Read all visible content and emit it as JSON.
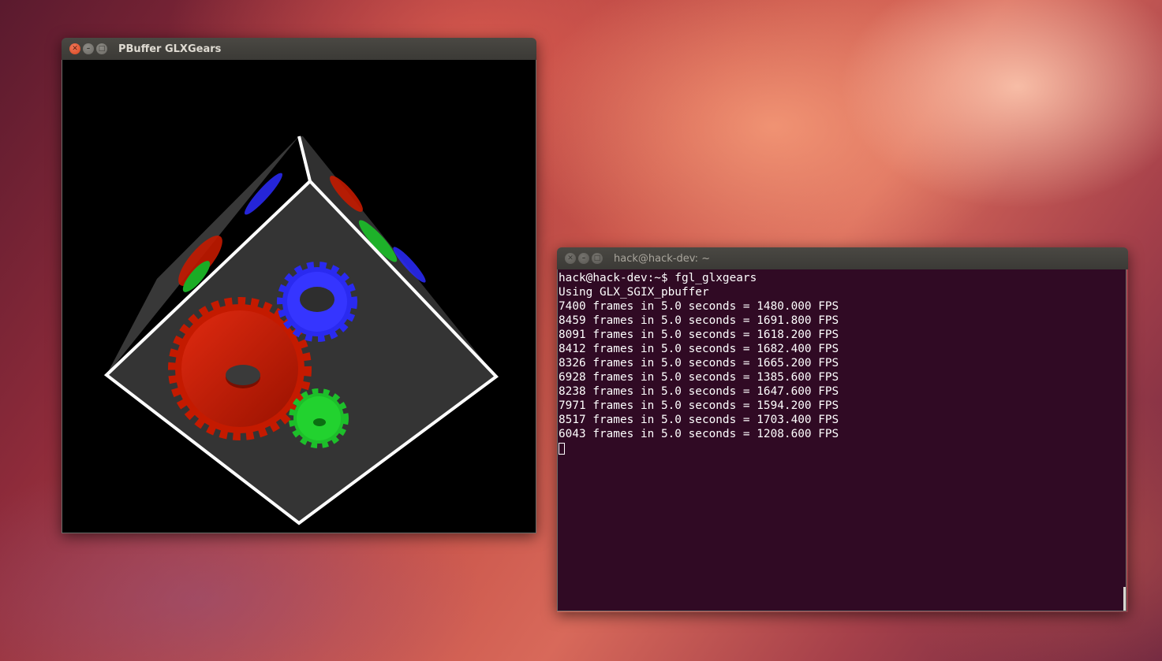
{
  "windows": {
    "glx": {
      "title": "PBuffer GLXGears",
      "buttons": {
        "close": "✕",
        "minimize": "–",
        "maximize": "□"
      }
    },
    "terminal": {
      "title": "hack@hack-dev: ~",
      "buttons": {
        "close": "✕",
        "minimize": "–",
        "maximize": "□"
      },
      "lines": [
        "hack@hack-dev:~$ fgl_glxgears",
        "Using GLX_SGIX_pbuffer",
        "7400 frames in 5.0 seconds = 1480.000 FPS",
        "8459 frames in 5.0 seconds = 1691.800 FPS",
        "8091 frames in 5.0 seconds = 1618.200 FPS",
        "8412 frames in 5.0 seconds = 1682.400 FPS",
        "8326 frames in 5.0 seconds = 1665.200 FPS",
        "6928 frames in 5.0 seconds = 1385.600 FPS",
        "8238 frames in 5.0 seconds = 1647.600 FPS",
        "7971 frames in 5.0 seconds = 1594.200 FPS",
        "8517 frames in 5.0 seconds = 1703.400 FPS",
        "6043 frames in 5.0 seconds = 1208.600 FPS"
      ]
    }
  },
  "colors": {
    "terminal_bg": "#300a24",
    "gear_red": "#c41a00",
    "gear_green": "#1dbf2a",
    "gear_blue": "#2a2af0",
    "cube_face": "#333333"
  }
}
